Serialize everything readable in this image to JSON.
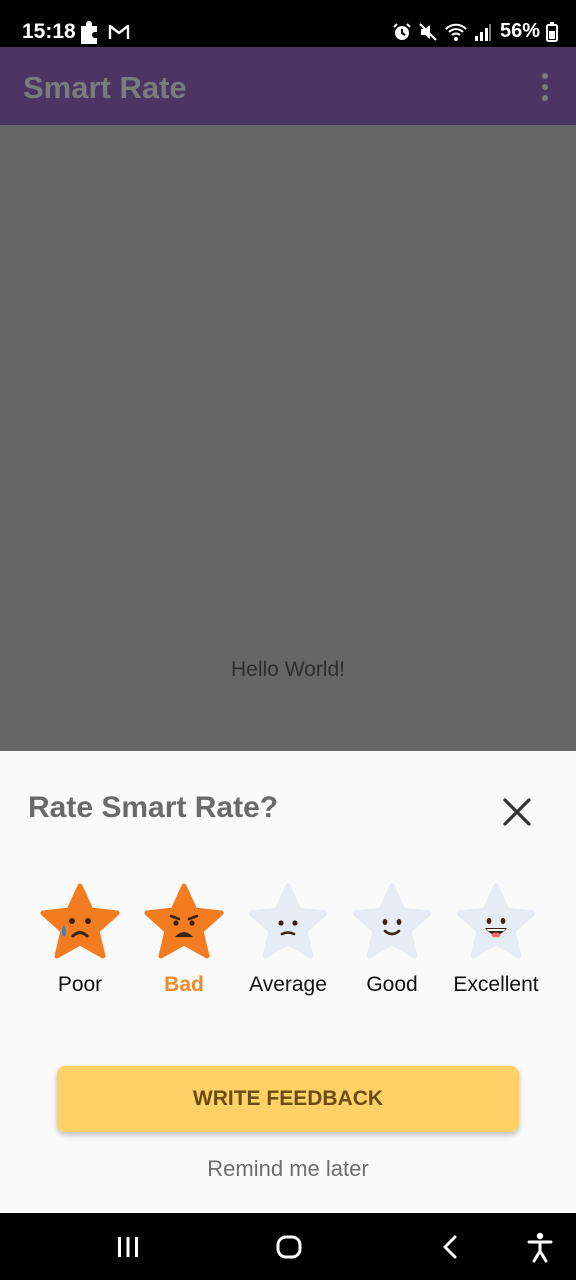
{
  "status_bar": {
    "time": "15:18",
    "battery": "56%",
    "left_icons": [
      "puzzle-icon",
      "gmail-icon"
    ],
    "right_icons": [
      "alarm-icon",
      "mute-icon",
      "wifi-icon",
      "signal-icon",
      "battery-icon"
    ]
  },
  "app_bar": {
    "title": "Smart Rate",
    "background": "#4b3663",
    "menu_icon": "overflow-menu-icon"
  },
  "content": {
    "hello_text": "Hello World!"
  },
  "rating_sheet": {
    "title": "Rate Smart Rate?",
    "close_icon": "close-icon",
    "options": [
      {
        "label": "Poor",
        "icon": "crying-star-icon",
        "color": "#f47c20"
      },
      {
        "label": "Bad",
        "icon": "sad-star-icon",
        "color": "#f47c20",
        "selected": true
      },
      {
        "label": "Average",
        "icon": "neutral-star-icon",
        "color": "#e6ebf4"
      },
      {
        "label": "Good",
        "icon": "smile-star-icon",
        "color": "#e6ebf4"
      },
      {
        "label": "Excellent",
        "icon": "grin-star-icon",
        "color": "#e6ebf4"
      }
    ],
    "feedback_button": "WRITE FEEDBACK",
    "remind_later": "Remind me later",
    "accent_color": "#ffd166",
    "selected_color": "#f28a2b"
  },
  "nav_bar": {
    "items": [
      "recents-icon",
      "home-icon",
      "back-icon",
      "accessibility-icon"
    ]
  }
}
